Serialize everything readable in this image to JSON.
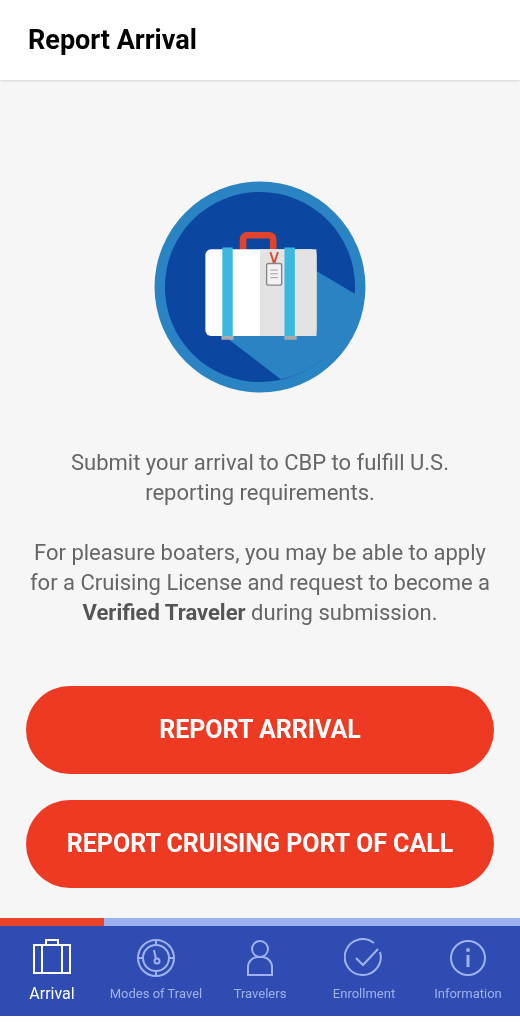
{
  "header": {
    "title": "Report Arrival"
  },
  "paragraphs": [
    "Submit your arrival to CBP to fulfill U.S. reporting requirements.",
    "For pleasure boaters, you may be able to apply for a Cruising License and request to become a **Verified Traveler** during submission."
  ],
  "buttons": [
    "REPORT ARRIVAL",
    "REPORT CRUISING PORT OF CALL"
  ],
  "tabs": [
    {
      "label": "Arrival",
      "kind": "suitcase",
      "selected": true
    },
    {
      "label": "Modes of Travel",
      "kind": "compass",
      "selected": false
    },
    {
      "label": "Travelers",
      "kind": "person",
      "selected": false
    },
    {
      "label": "Enrollment",
      "kind": "check",
      "selected": false
    },
    {
      "label": "Information",
      "kind": "info",
      "selected": false
    }
  ]
}
